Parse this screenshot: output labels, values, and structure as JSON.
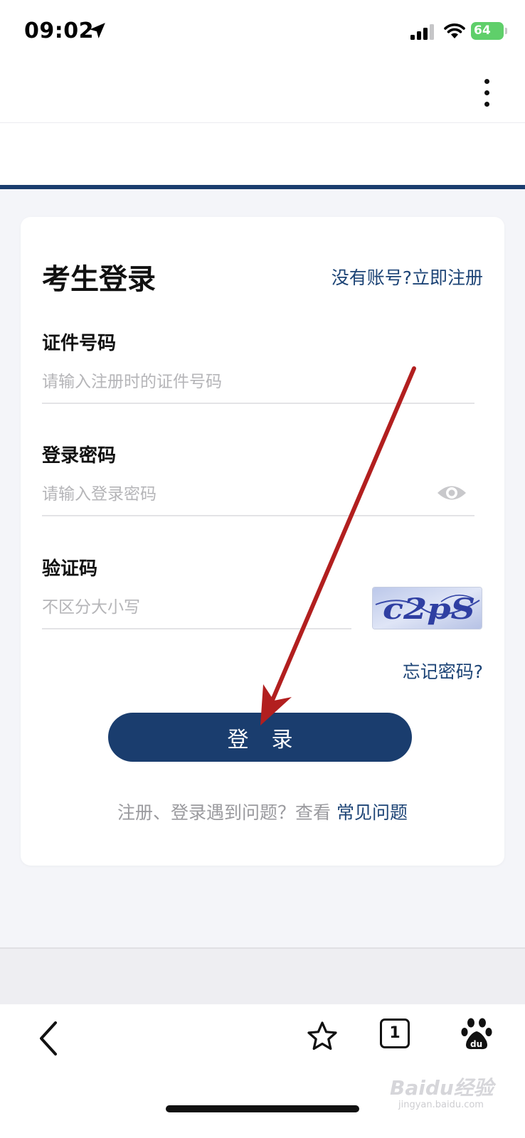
{
  "status_bar": {
    "time": "09:02",
    "battery": "64",
    "icons": [
      "location-arrow-icon",
      "signal-icon",
      "wifi-icon",
      "battery-icon"
    ]
  },
  "header": {
    "menu_icon": "more-vertical-icon"
  },
  "login": {
    "title": "考生登录",
    "register_link": "没有账号?立即注册",
    "id_label": "证件号码",
    "id_placeholder": "请输入注册时的证件号码",
    "password_label": "登录密码",
    "password_placeholder": "请输入登录密码",
    "password_toggle_icon": "eye-icon",
    "captcha_label": "验证码",
    "captcha_placeholder": "不区分大小写",
    "captcha_text": "c2pS",
    "forgot_link": "忘记密码?",
    "submit_label": "登录",
    "help_text": "注册、登录遇到问题？查看",
    "faq_link": "常见问题"
  },
  "annotation": {
    "arrow_color": "#b21f1f"
  },
  "bottom_nav": {
    "tab_count": "1",
    "icons": [
      "back-icon",
      "star-icon",
      "tabs-icon",
      "baidu-paw-icon"
    ]
  },
  "watermark": {
    "text": "Baidu经验",
    "sub": "jingyan.baidu.com"
  },
  "colors": {
    "brand": "#1a3d6e",
    "link": "#1d4476",
    "placeholder": "#b5b5b8"
  }
}
